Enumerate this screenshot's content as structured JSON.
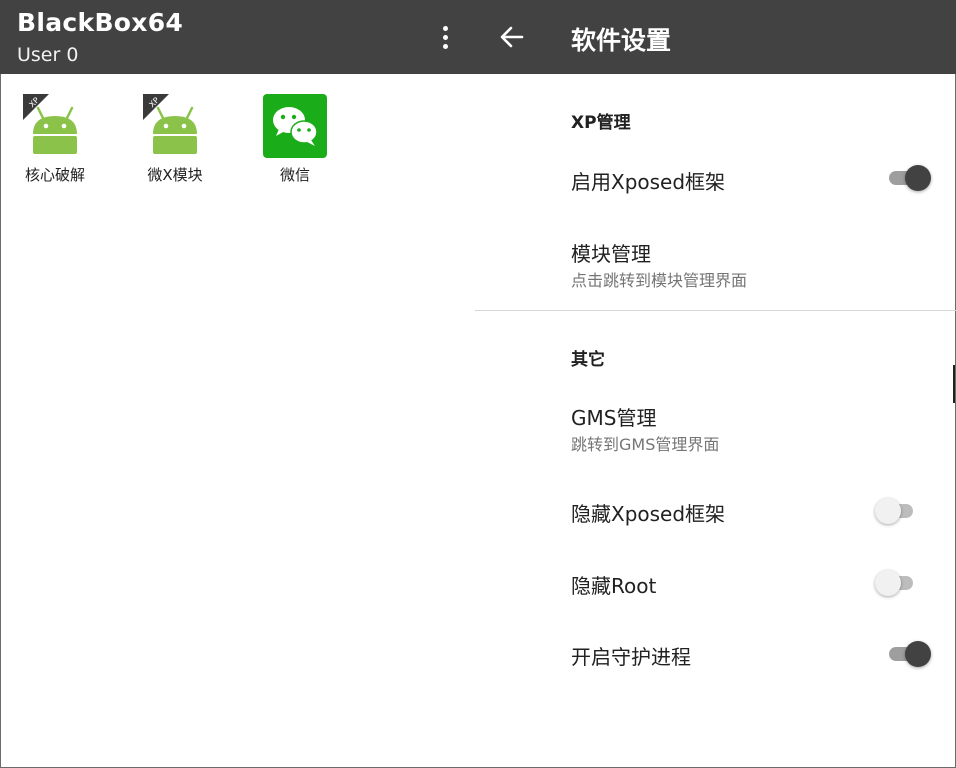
{
  "left": {
    "title": "BlackBox64",
    "subtitle": "User 0",
    "menu_icon": "more-vert-icon",
    "apps": [
      {
        "label": "核心破解",
        "icon": "android-xp-icon",
        "badge": "XP"
      },
      {
        "label": "微X模块",
        "icon": "android-xp-icon",
        "badge": "XP"
      },
      {
        "label": "微信",
        "icon": "wechat-icon"
      }
    ]
  },
  "right": {
    "back_icon": "arrow-back-icon",
    "title": "软件设置",
    "sections": [
      {
        "header": "XP管理",
        "items": [
          {
            "title": "启用Xposed框架",
            "switch": true
          },
          {
            "title": "模块管理",
            "summary": "点击跳转到模块管理界面"
          }
        ]
      },
      {
        "header": "其它",
        "items": [
          {
            "title": "GMS管理",
            "summary": "跳转到GMS管理界面"
          },
          {
            "title": "隐藏Xposed框架",
            "switch": false
          },
          {
            "title": "隐藏Root",
            "switch": false
          },
          {
            "title": "开启守护进程",
            "switch": true
          }
        ]
      }
    ]
  },
  "colors": {
    "toolbar": "#424242",
    "android_green": "#8BC34A",
    "wechat_green": "#1AAD19",
    "switch_on_thumb": "#424242",
    "switch_off_thumb": "#f1f1f1"
  }
}
